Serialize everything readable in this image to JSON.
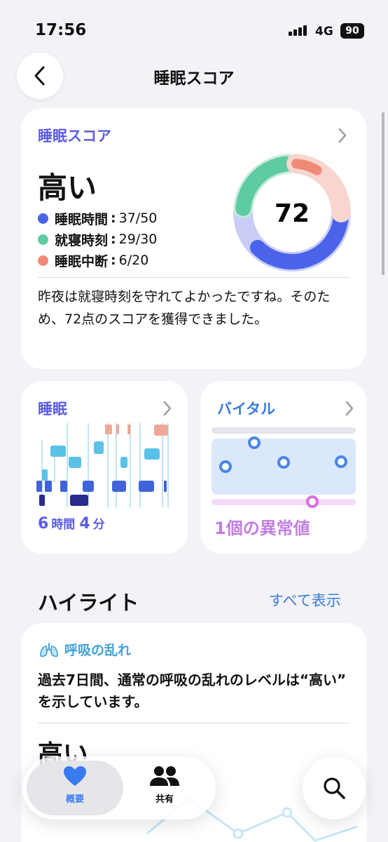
{
  "status": {
    "time": "17:56",
    "network": "4G",
    "battery": "90"
  },
  "nav": {
    "title": "睡眠スコア"
  },
  "score_card": {
    "heading": "睡眠スコア",
    "rating": "高い",
    "score": "72",
    "metrics": [
      {
        "name": "睡眠時間",
        "value": "37/50",
        "color": "#4a63e8",
        "fraction": 0.74
      },
      {
        "name": "就寝時刻",
        "value": "29/30",
        "color": "#5ecba1",
        "fraction": 0.967
      },
      {
        "name": "睡眠中断",
        "value": "6/20",
        "color": "#ef8a78",
        "fraction": 0.3
      }
    ],
    "summary": "昨夜は就寝時刻を守れてよかったですね。そのため、72点のスコアを獲得できました。"
  },
  "sleep_card": {
    "heading": "睡眠",
    "hours": "6",
    "hours_unit": "時間",
    "minutes": "4",
    "minutes_unit": "分"
  },
  "vital_card": {
    "heading": "バイタル",
    "value": "1個の異常値"
  },
  "highlights": {
    "title": "ハイライト",
    "see_all": "すべて表示",
    "item": {
      "tag": "呼吸の乱れ",
      "text": "過去7日間、通常の呼吸の乱れのレベルは“高い” を示しています。",
      "value": "高い"
    }
  },
  "tabbar": {
    "tabs": [
      {
        "label": "概要",
        "icon": "heart-icon"
      },
      {
        "label": "共有",
        "icon": "people-icon"
      }
    ]
  },
  "colors": {
    "accent": "#5b5ce2",
    "link": "#3a7bd5",
    "vital": "#c17fe0",
    "highlight_tag": "#3fa2d6"
  }
}
